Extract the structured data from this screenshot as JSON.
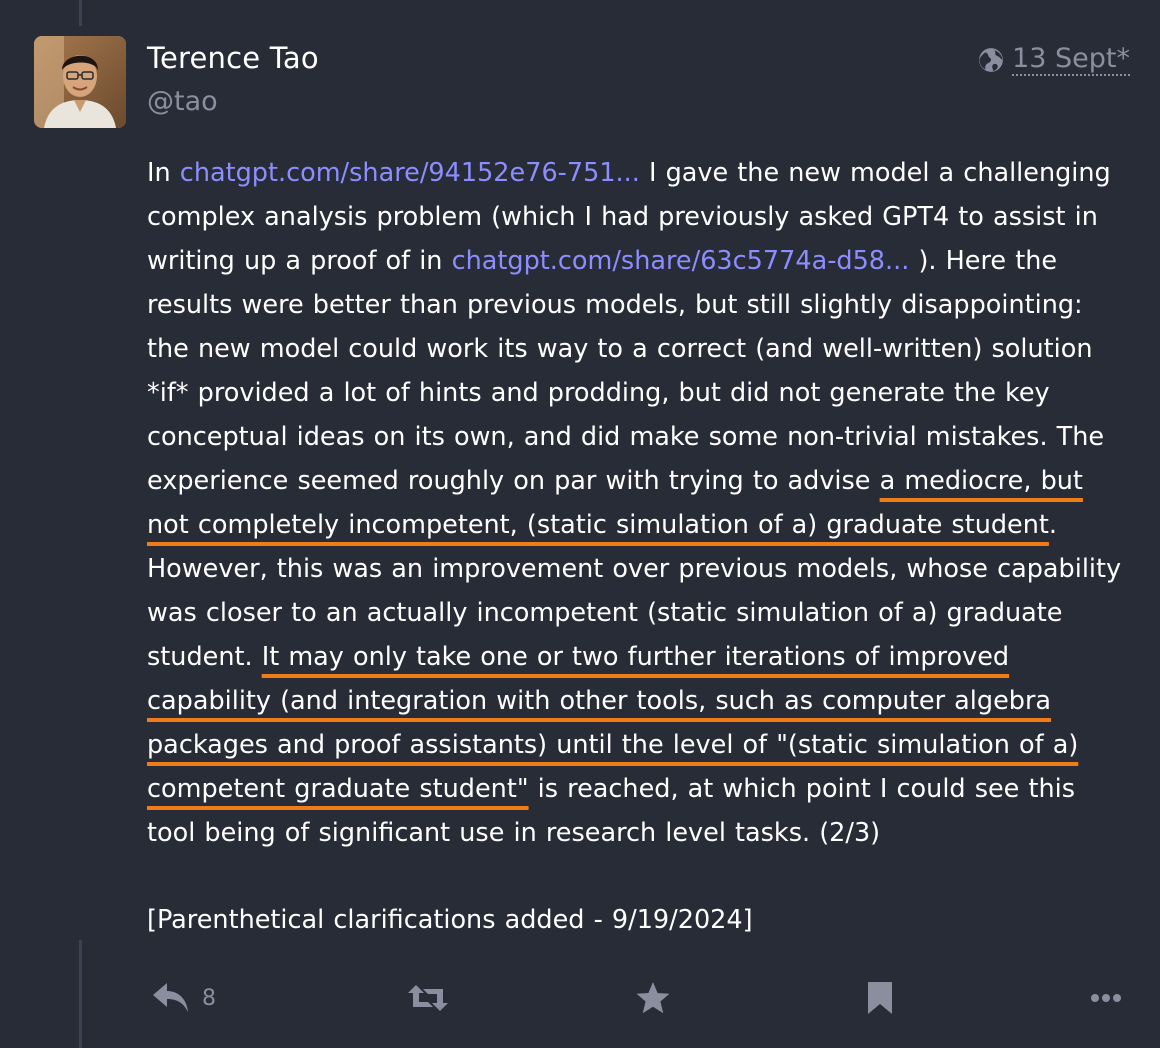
{
  "status": {
    "author": {
      "display_name": "Terence Tao",
      "handle": "@tao",
      "avatar_icon": "profile-photo"
    },
    "visibility_icon": "globe-icon",
    "timestamp": "13 Sept",
    "edited_marker": "*",
    "content": {
      "p1_intro": "In ",
      "link1": "chatgpt.com/share/94152e76-751...",
      "p1_a": " I gave the new model a challenging complex analysis problem (which I had previously asked GPT4 to assist in writing up a proof of in  ",
      "link2": "chatgpt.com/share/63c5774a-d58...",
      "p1_b": " ).  Here the results were better than previous models, but still slightly disappointing: the new model could work its way to a correct (and well-written) solution *if* provided a lot of hints and prodding, but did not generate the key conceptual ideas on its own, and did make some non-trivial mistakes.  The experience seemed roughly on par with trying to advise ",
      "highlight1": "a mediocre, but not completely incompetent, (static simulation of a) graduate student",
      "p1_c": ".  However, this was an improvement over previous models, whose capability was closer to an actually incompetent (static simulation of a) graduate student.  ",
      "highlight2": "It may only take one or two further iterations of improved capability (and integration with other tools, such as computer algebra packages and proof assistants) until the level of \"(static simulation of a) competent graduate student\"",
      "p1_d": " is reached, at which point I could see this tool being of significant use in research level tasks. (2/3)",
      "p2": "[Parenthetical clarifications added - 9/19/2024]"
    },
    "annotation_color": "#f07c1a",
    "link_color": "#8c8dff",
    "actions": {
      "reply": {
        "icon": "reply-icon",
        "count": "8"
      },
      "boost": {
        "icon": "boost-icon"
      },
      "favourite": {
        "icon": "star-icon"
      },
      "bookmark": {
        "icon": "bookmark-icon"
      },
      "more": {
        "icon": "more-icon"
      }
    }
  }
}
